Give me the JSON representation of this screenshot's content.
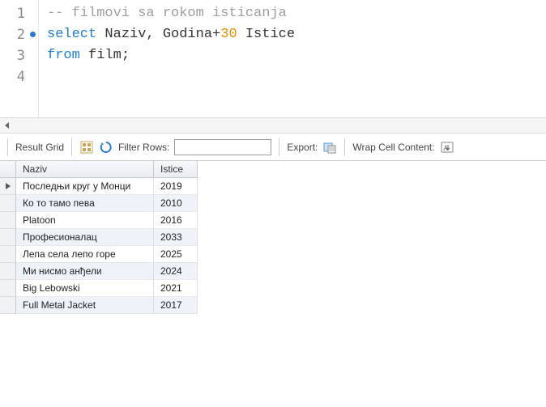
{
  "editor": {
    "lines": [
      {
        "num": 1,
        "marker": false,
        "tokens": [
          {
            "cls": "comment",
            "t": "-- filmovi sa rokom isticanja"
          }
        ]
      },
      {
        "num": 2,
        "marker": true,
        "tokens": [
          {
            "cls": "kw",
            "t": "select"
          },
          {
            "cls": "plain",
            "t": " Naziv, Godina+"
          },
          {
            "cls": "num",
            "t": "30"
          },
          {
            "cls": "plain",
            "t": " Istice"
          }
        ]
      },
      {
        "num": 3,
        "marker": false,
        "tokens": [
          {
            "cls": "kw",
            "t": "from"
          },
          {
            "cls": "plain",
            "t": " film;"
          }
        ]
      },
      {
        "num": 4,
        "marker": false,
        "tokens": []
      }
    ]
  },
  "toolbar": {
    "result_grid_label": "Result Grid",
    "filter_label": "Filter Rows:",
    "filter_value": "",
    "export_label": "Export:",
    "wrap_label": "Wrap Cell Content:"
  },
  "grid": {
    "columns": [
      "Naziv",
      "Istice"
    ],
    "rows": [
      {
        "Naziv": "Последњи круг у Монци",
        "Istice": "2019"
      },
      {
        "Naziv": "Ко то тамо пева",
        "Istice": "2010"
      },
      {
        "Naziv": "Platoon",
        "Istice": "2016"
      },
      {
        "Naziv": "Професионалац",
        "Istice": "2033"
      },
      {
        "Naziv": "Лепа села лепо горе",
        "Istice": "2025"
      },
      {
        "Naziv": "Ми нисмо анђели",
        "Istice": "2024"
      },
      {
        "Naziv": "Big Lebowski",
        "Istice": "2021"
      },
      {
        "Naziv": "Full Metal Jacket",
        "Istice": "2017"
      }
    ],
    "selected_row": 0
  }
}
